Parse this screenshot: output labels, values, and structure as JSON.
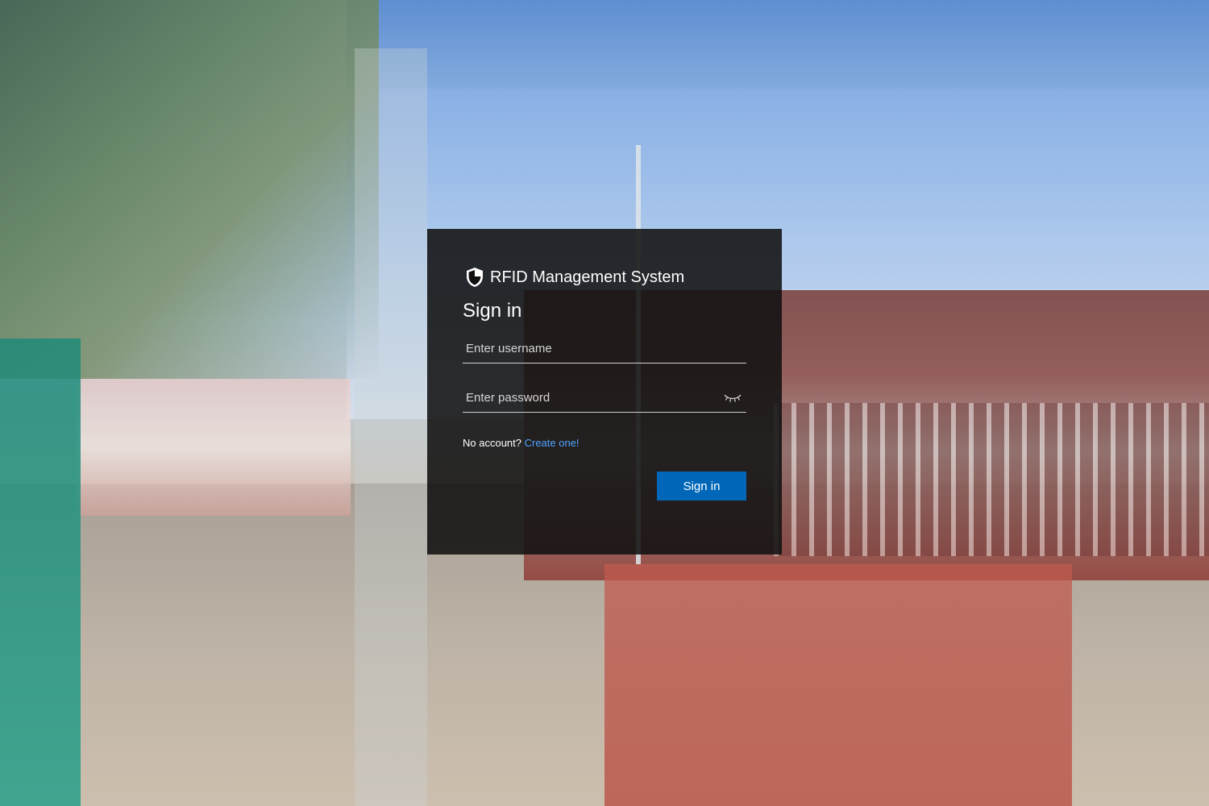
{
  "brand": {
    "title": "RFID Management System",
    "icon": "shield-icon"
  },
  "signin": {
    "heading": "Sign in",
    "username": {
      "placeholder": "Enter username",
      "value": ""
    },
    "password": {
      "placeholder": "Enter password",
      "value": "",
      "toggle_icon": "eye-closed-icon"
    },
    "no_account_text": "No account?",
    "create_link": "Create one!",
    "submit_label": "Sign in"
  },
  "colors": {
    "dialog_bg": "#111111",
    "accent": "#0067b8",
    "link": "#4ea3ff"
  }
}
